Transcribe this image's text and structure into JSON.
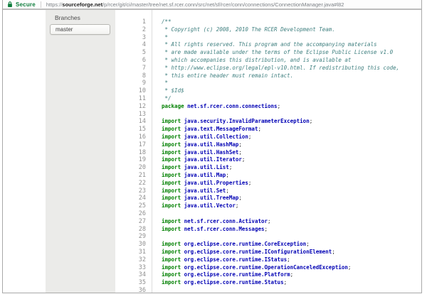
{
  "browser": {
    "secure_label": "Secure",
    "secure_color": "#0e7d3c",
    "url_scheme": "https://",
    "url_domain": "sourceforge.net",
    "url_path": "/p/rcer/git/ci/master/tree/net.sf.rcer.conn/src/net/sf/rcer/conn/connections/ConnectionManager.java#l82"
  },
  "sidebar": {
    "heading": "Branches",
    "branches": [
      {
        "label": "master"
      }
    ]
  },
  "code": {
    "language": "java",
    "colors": {
      "comment": "#408080",
      "keyword": "#008000",
      "namespace": "#0000b4",
      "plain": "#1f1f1f",
      "line_number": "#8f8f8f"
    },
    "lines": [
      {
        "n": 1,
        "seg": [
          [
            "com",
            "/**"
          ]
        ]
      },
      {
        "n": 2,
        "seg": [
          [
            "com",
            " * Copyright (c) 2008, 2010 The RCER Development Team."
          ]
        ]
      },
      {
        "n": 3,
        "seg": [
          [
            "com",
            " *"
          ]
        ]
      },
      {
        "n": 4,
        "seg": [
          [
            "com",
            " * All rights reserved. This program and the accompanying materials"
          ]
        ]
      },
      {
        "n": 5,
        "seg": [
          [
            "com",
            " * are made available under the terms of the Eclipse Public License v1.0"
          ]
        ]
      },
      {
        "n": 6,
        "seg": [
          [
            "com",
            " * which accompanies this distribution, and is available at"
          ]
        ]
      },
      {
        "n": 7,
        "seg": [
          [
            "com",
            " * http://www.eclipse.org/legal/epl-v10.html. If redistributing this code,"
          ]
        ]
      },
      {
        "n": 8,
        "seg": [
          [
            "com",
            " * this entire header must remain intact."
          ]
        ]
      },
      {
        "n": 9,
        "seg": [
          [
            "com",
            " *"
          ]
        ]
      },
      {
        "n": 10,
        "seg": [
          [
            "com",
            " * $Id$"
          ]
        ]
      },
      {
        "n": 11,
        "seg": [
          [
            "com",
            " */"
          ]
        ]
      },
      {
        "n": 12,
        "seg": [
          [
            "kw",
            "package"
          ],
          [
            "pln",
            " "
          ],
          [
            "ns",
            "net.sf.rcer.conn.connections"
          ],
          [
            "pln",
            ";"
          ]
        ]
      },
      {
        "n": 13,
        "seg": []
      },
      {
        "n": 14,
        "seg": [
          [
            "kw",
            "import"
          ],
          [
            "pln",
            " "
          ],
          [
            "ns",
            "java.security.InvalidParameterException"
          ],
          [
            "pln",
            ";"
          ]
        ]
      },
      {
        "n": 15,
        "seg": [
          [
            "kw",
            "import"
          ],
          [
            "pln",
            " "
          ],
          [
            "ns",
            "java.text.MessageFormat"
          ],
          [
            "pln",
            ";"
          ]
        ]
      },
      {
        "n": 16,
        "seg": [
          [
            "kw",
            "import"
          ],
          [
            "pln",
            " "
          ],
          [
            "ns",
            "java.util.Collection"
          ],
          [
            "pln",
            ";"
          ]
        ]
      },
      {
        "n": 17,
        "seg": [
          [
            "kw",
            "import"
          ],
          [
            "pln",
            " "
          ],
          [
            "ns",
            "java.util.HashMap"
          ],
          [
            "pln",
            ";"
          ]
        ]
      },
      {
        "n": 18,
        "seg": [
          [
            "kw",
            "import"
          ],
          [
            "pln",
            " "
          ],
          [
            "ns",
            "java.util.HashSet"
          ],
          [
            "pln",
            ";"
          ]
        ]
      },
      {
        "n": 19,
        "seg": [
          [
            "kw",
            "import"
          ],
          [
            "pln",
            " "
          ],
          [
            "ns",
            "java.util.Iterator"
          ],
          [
            "pln",
            ";"
          ]
        ]
      },
      {
        "n": 20,
        "seg": [
          [
            "kw",
            "import"
          ],
          [
            "pln",
            " "
          ],
          [
            "ns",
            "java.util.List"
          ],
          [
            "pln",
            ";"
          ]
        ]
      },
      {
        "n": 21,
        "seg": [
          [
            "kw",
            "import"
          ],
          [
            "pln",
            " "
          ],
          [
            "ns",
            "java.util.Map"
          ],
          [
            "pln",
            ";"
          ]
        ]
      },
      {
        "n": 22,
        "seg": [
          [
            "kw",
            "import"
          ],
          [
            "pln",
            " "
          ],
          [
            "ns",
            "java.util.Properties"
          ],
          [
            "pln",
            ";"
          ]
        ]
      },
      {
        "n": 23,
        "seg": [
          [
            "kw",
            "import"
          ],
          [
            "pln",
            " "
          ],
          [
            "ns",
            "java.util.Set"
          ],
          [
            "pln",
            ";"
          ]
        ]
      },
      {
        "n": 24,
        "seg": [
          [
            "kw",
            "import"
          ],
          [
            "pln",
            " "
          ],
          [
            "ns",
            "java.util.TreeMap"
          ],
          [
            "pln",
            ";"
          ]
        ]
      },
      {
        "n": 25,
        "seg": [
          [
            "kw",
            "import"
          ],
          [
            "pln",
            " "
          ],
          [
            "ns",
            "java.util.Vector"
          ],
          [
            "pln",
            ";"
          ]
        ]
      },
      {
        "n": 26,
        "seg": []
      },
      {
        "n": 27,
        "seg": [
          [
            "kw",
            "import"
          ],
          [
            "pln",
            " "
          ],
          [
            "ns",
            "net.sf.rcer.conn.Activator"
          ],
          [
            "pln",
            ";"
          ]
        ]
      },
      {
        "n": 28,
        "seg": [
          [
            "kw",
            "import"
          ],
          [
            "pln",
            " "
          ],
          [
            "ns",
            "net.sf.rcer.conn.Messages"
          ],
          [
            "pln",
            ";"
          ]
        ]
      },
      {
        "n": 29,
        "seg": []
      },
      {
        "n": 30,
        "seg": [
          [
            "kw",
            "import"
          ],
          [
            "pln",
            " "
          ],
          [
            "ns",
            "org.eclipse.core.runtime.CoreException"
          ],
          [
            "pln",
            ";"
          ]
        ]
      },
      {
        "n": 31,
        "seg": [
          [
            "kw",
            "import"
          ],
          [
            "pln",
            " "
          ],
          [
            "ns",
            "org.eclipse.core.runtime.IConfigurationElement"
          ],
          [
            "pln",
            ";"
          ]
        ]
      },
      {
        "n": 32,
        "seg": [
          [
            "kw",
            "import"
          ],
          [
            "pln",
            " "
          ],
          [
            "ns",
            "org.eclipse.core.runtime.IStatus"
          ],
          [
            "pln",
            ";"
          ]
        ]
      },
      {
        "n": 33,
        "seg": [
          [
            "kw",
            "import"
          ],
          [
            "pln",
            " "
          ],
          [
            "ns",
            "org.eclipse.core.runtime.OperationCanceledException"
          ],
          [
            "pln",
            ";"
          ]
        ]
      },
      {
        "n": 34,
        "seg": [
          [
            "kw",
            "import"
          ],
          [
            "pln",
            " "
          ],
          [
            "ns",
            "org.eclipse.core.runtime.Platform"
          ],
          [
            "pln",
            ";"
          ]
        ]
      },
      {
        "n": 35,
        "seg": [
          [
            "kw",
            "import"
          ],
          [
            "pln",
            " "
          ],
          [
            "ns",
            "org.eclipse.core.runtime.Status"
          ],
          [
            "pln",
            ";"
          ]
        ]
      },
      {
        "n": 36,
        "seg": []
      }
    ]
  }
}
